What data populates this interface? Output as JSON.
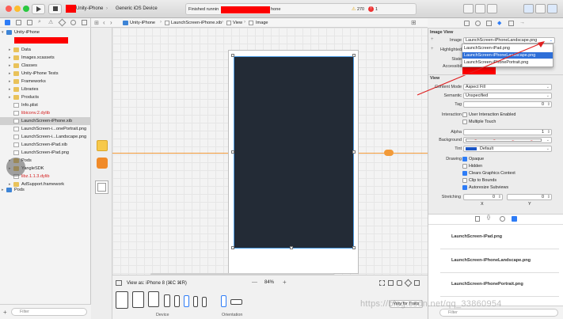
{
  "toolbar": {
    "scheme_target": "Unity-iPhone",
    "scheme_device": "Generic iOS Device",
    "status_prefix": "Finished runnin",
    "status_suffix": "hone",
    "warning_count": "270",
    "error_count": "1"
  },
  "navigator": {
    "project": "Unity-iPhone",
    "items": [
      {
        "label": "Data",
        "kind": "folder"
      },
      {
        "label": "Images.xcassets",
        "kind": "folder"
      },
      {
        "label": "Classes",
        "kind": "folder"
      },
      {
        "label": "Unity-iPhone Tests",
        "kind": "folder"
      },
      {
        "label": "Frameworks",
        "kind": "folder"
      },
      {
        "label": "Libraries",
        "kind": "folder"
      },
      {
        "label": "Products",
        "kind": "folder"
      },
      {
        "label": "Info.plist",
        "kind": "file"
      },
      {
        "label": "libiconv.2.dylib",
        "kind": "file",
        "missing": true
      },
      {
        "label": "LaunchScreen-iPhone.xib",
        "kind": "file",
        "selected": true
      },
      {
        "label": "LaunchScreen-i...onePortrait.png",
        "kind": "file"
      },
      {
        "label": "LaunchScreen-i...Landscape.png",
        "kind": "file"
      },
      {
        "label": "LaunchScreen-iPad.xib",
        "kind": "file"
      },
      {
        "label": "LaunchScreen-iPad.png",
        "kind": "file"
      },
      {
        "label": "Pods",
        "kind": "folder"
      },
      {
        "label": "YangleSDK",
        "kind": "folder"
      },
      {
        "label": "libz.1.1.3.dylib",
        "kind": "file",
        "missing": true
      },
      {
        "label": "AdSupport.framework",
        "kind": "folder"
      }
    ],
    "pods": "Pods",
    "filter_placeholder": "Filter"
  },
  "jumpbar": {
    "crumbs": [
      "Unity-iPhone",
      "LaunchScreen-iPhone.xib",
      "View",
      "Image"
    ]
  },
  "editor": {
    "view_as": "View as: iPhone 8 (⌘C ⌘R)",
    "zoom": "84%",
    "zoom_minus": "—",
    "zoom_plus": "+",
    "device_label": "Device",
    "orientation_label": "Orientation",
    "vary_traits": "Vary for Traits"
  },
  "inspector": {
    "image_view_title": "Image View",
    "image_label": "Image",
    "image_value": "LaunchScreen-iPhoneLandscape.png",
    "highlighted_label": "Highlighted",
    "state_label": "State",
    "accessibility_label": "Accessibil",
    "dropdown_options": [
      "LaunchScreen-iPad.png",
      "LaunchScreen-iPhoneLandscape.png",
      "LaunchScreen-iPhonePortrait.png"
    ],
    "view_title": "View",
    "content_mode_label": "Content Mode",
    "content_mode": "Aspect Fill",
    "semantic_label": "Semantic",
    "semantic": "Unspecified",
    "tag_label": "Tag",
    "tag": "0",
    "interaction_label": "Interaction",
    "user_interaction": "User Interaction Enabled",
    "multiple_touch": "Multiple Touch",
    "alpha_label": "Alpha",
    "alpha": "1",
    "background_label": "Background",
    "tint_label": "Tint",
    "tint": "Default",
    "drawing_label": "Drawing",
    "opaque": "Opaque",
    "hidden": "Hidden",
    "clears_graphics": "Clears Graphics Context",
    "clip_bounds": "Clip to Bounds",
    "autoresize": "Autoresize Subviews",
    "stretching_label": "Stretching",
    "stretch_x": "0",
    "stretch_y": "0",
    "x_label": "X",
    "y_label": "Y",
    "tint_color": "#1a56c6"
  },
  "library": {
    "items": [
      "LaunchScreen-iPad.png",
      "LaunchScreen-iPhoneLandscape.png",
      "LaunchScreen-iPhonePortrait.png"
    ],
    "filter_placeholder": "Filter"
  },
  "watermark": "https://blog.csdn.net/qq_33860954"
}
